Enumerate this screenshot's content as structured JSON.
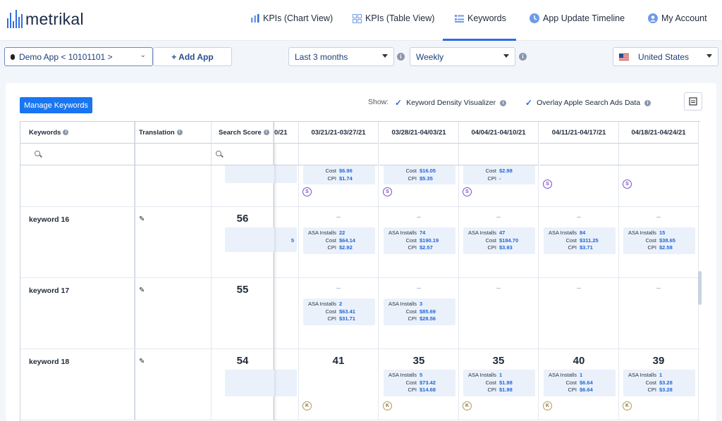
{
  "brand": {
    "name": "metrikal",
    "accent": "#2f6de1"
  },
  "nav": {
    "items": [
      {
        "label": "KPIs (Chart View)",
        "icon": "bar-chart-icon"
      },
      {
        "label": "KPIs (Table View)",
        "icon": "grid-icon"
      },
      {
        "label": "Keywords",
        "icon": "keywords-icon",
        "active": true
      },
      {
        "label": "App Update Timeline",
        "icon": "clock-icon"
      },
      {
        "label": "My Account",
        "icon": "user-icon"
      }
    ]
  },
  "filters": {
    "app": "Demo App < 10101101 >",
    "add_app": "+ Add App",
    "date_range": "Last 3 months",
    "granularity": "Weekly",
    "country": "United States"
  },
  "toolbar": {
    "manage_keywords": "Manage Keywords",
    "show_label": "Show:",
    "keyword_density": "Keyword Density Visualizer",
    "overlay_asa": "Overlay Apple Search Ads Data"
  },
  "table": {
    "headers": {
      "keywords": "Keywords",
      "translation": "Translation",
      "search_score": "Search Score",
      "partial_week": "0/21"
    },
    "weeks": [
      "03/21/21-03/27/21",
      "03/28/21-04/03/21",
      "04/04/21-04/10/21",
      "04/11/21-04/17/21",
      "04/18/21-04/24/21"
    ],
    "labels": {
      "asa_installs": "ASA Installs",
      "cost": "Cost",
      "cpi": "CPI",
      "dash": "–",
      "badge_s": "S",
      "badge_k": "K"
    },
    "top_partial": [
      {
        "cost": "$6.96",
        "cpi": "$1.74"
      },
      {
        "cost": "$16.05",
        "cpi": "$5.35"
      },
      {
        "cost": "$2.98",
        "cpi": "-"
      }
    ],
    "rows": [
      {
        "keyword": "keyword 16",
        "score": "56",
        "partial_installs": "5",
        "weeks": [
          {
            "rank": "–",
            "installs": "22",
            "cost": "$64.14",
            "cpi": "$2.92"
          },
          {
            "rank": "–",
            "installs": "74",
            "cost": "$190.19",
            "cpi": "$2.57"
          },
          {
            "rank": "–",
            "installs": "47",
            "cost": "$184.70",
            "cpi": "$3.93"
          },
          {
            "rank": "–",
            "installs": "84",
            "cost": "$311.25",
            "cpi": "$3.71"
          },
          {
            "rank": "–",
            "installs": "15",
            "cost": "$38.65",
            "cpi": "$2.58"
          }
        ]
      },
      {
        "keyword": "keyword 17",
        "score": "55",
        "weeks": [
          {
            "rank": "–",
            "installs": "2",
            "cost": "$63.41",
            "cpi": "$31.71"
          },
          {
            "rank": "–",
            "installs": "3",
            "cost": "$85.69",
            "cpi": "$28.56"
          },
          {
            "rank": "–"
          },
          {
            "rank": "–"
          },
          {
            "rank": "–"
          }
        ]
      },
      {
        "keyword": "keyword 18",
        "score": "54",
        "weeks": [
          {
            "rank": "41"
          },
          {
            "rank": "35",
            "installs": "5",
            "cost": "$73.42",
            "cpi": "$14.68"
          },
          {
            "rank": "35",
            "installs": "1",
            "cost": "$1.98",
            "cpi": "$1.98"
          },
          {
            "rank": "40",
            "installs": "1",
            "cost": "$6.64",
            "cpi": "$6.64"
          },
          {
            "rank": "39",
            "installs": "1",
            "cost": "$3.28",
            "cpi": "$3.28"
          }
        ]
      }
    ]
  }
}
